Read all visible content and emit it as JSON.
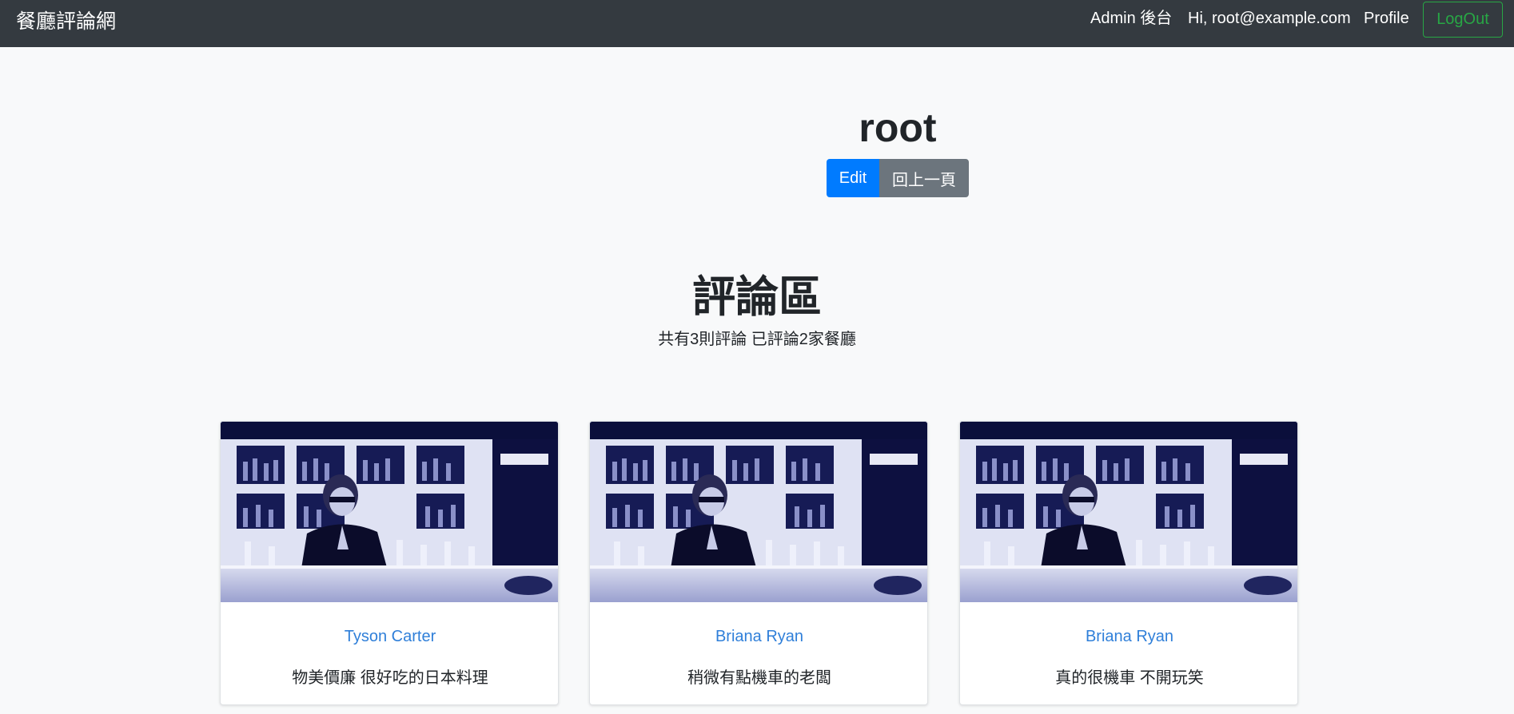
{
  "navbar": {
    "brand": "餐廳評論網",
    "admin_link": "Admin 後台",
    "greeting": "Hi, root@example.com",
    "profile_link": "Profile",
    "logout_label": "LogOut",
    "logout_color": "#28a745",
    "background": "#343a40"
  },
  "profile": {
    "name": "root",
    "edit_label": "Edit",
    "back_label": "回上一頁"
  },
  "reviews_section": {
    "title": "評論區",
    "summary": "共有3則評論 已評論2家餐廳"
  },
  "reviews": [
    {
      "restaurant": "Tyson Carter",
      "comment": "物美價廉 很好吃的日本料理",
      "image": "bartender-photo"
    },
    {
      "restaurant": "Briana Ryan",
      "comment": "稍微有點機車的老闆",
      "image": "bartender-photo"
    },
    {
      "restaurant": "Briana Ryan",
      "comment": "真的很機車 不開玩笑",
      "image": "bartender-photo"
    }
  ],
  "colors": {
    "primary": "#007bff",
    "secondary": "#6c757d",
    "link": "#2f7fd9",
    "page_bg": "#f8f9fa"
  }
}
